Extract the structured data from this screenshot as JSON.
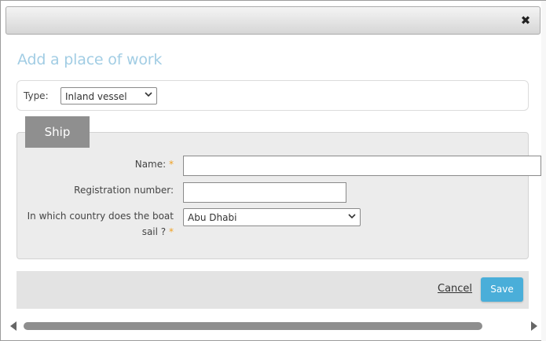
{
  "dialog": {
    "close_symbol": "✖",
    "heading": "Add a place of work"
  },
  "type_field": {
    "label": "Type:",
    "selected": "Inland vessel"
  },
  "ship_section": {
    "tab_label": "Ship",
    "name": {
      "label": "Name:",
      "required_mark": "*",
      "value": ""
    },
    "registration": {
      "label": "Registration number:",
      "value": ""
    },
    "country": {
      "label_line1": "In which country does the boat",
      "label_line2": "sail ?",
      "required_mark": "*",
      "selected": "Abu Dhabi"
    }
  },
  "footer": {
    "cancel_label": "Cancel",
    "save_label": "Save"
  },
  "colors": {
    "heading": "#a2cde4",
    "save_button": "#4aaed9",
    "required": "#f0a020",
    "tab": "#8f8f8f"
  },
  "icons": [
    "close-icon",
    "chevron-down-icon",
    "scroll-left-arrow-icon",
    "scroll-right-arrow-icon"
  ]
}
